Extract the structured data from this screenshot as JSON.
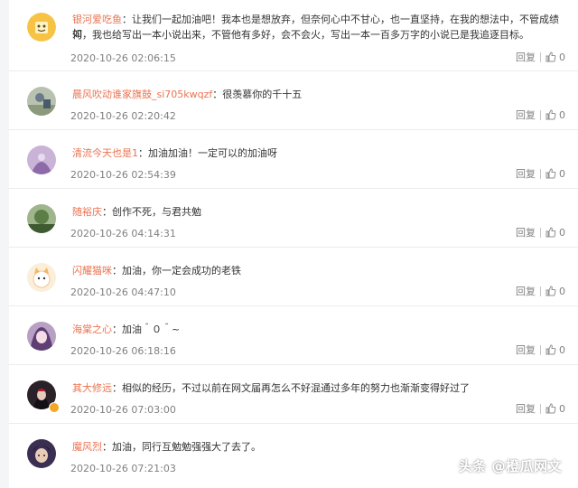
{
  "comments": [
    {
      "user": "银河爱吃鱼",
      "text_l1": "让我们一起加油吧！我本也是想放弃，但奈何心中不甘心，也一直坚持，在我的想法中，不管成绩如",
      "text_l2": "何，我也给写出一本小说出来，不管他有多好，会不会火，写出一本一百多万字的小说已是我追逐目标。",
      "time": "2020-10-26 02:06:15",
      "reply": "回复",
      "likes": "0",
      "avatar_icon": "yellow-cartoon-avatar"
    },
    {
      "user": "晨风吹动谁家旗鼓_si705kwqzf",
      "text_l1": "很羡慕你的千十五",
      "time": "2020-10-26 02:20:42",
      "reply": "回复",
      "likes": "0",
      "avatar_icon": "photo-avatar"
    },
    {
      "user": "清流今天也是1",
      "text_l1": "加油加油！一定可以的加油呀",
      "time": "2020-10-26 02:54:39",
      "reply": "回复",
      "likes": "0",
      "avatar_icon": "purple-avatar"
    },
    {
      "user": "随裕庆",
      "text_l1": "创作不死，与君共勉",
      "time": "2020-10-26 04:14:31",
      "reply": "回复",
      "likes": "0",
      "avatar_icon": "landscape-avatar"
    },
    {
      "user": "闪耀猫咪",
      "text_l1": "加油，你一定会成功的老铁",
      "time": "2020-10-26 04:47:10",
      "reply": "回复",
      "likes": "0",
      "avatar_icon": "cat-avatar"
    },
    {
      "user": "海棠之心",
      "text_l1": "加油＾０＾~",
      "time": "2020-10-26 06:18:16",
      "reply": "回复",
      "likes": "0",
      "avatar_icon": "anime-avatar"
    },
    {
      "user": "其大修远",
      "text_l1": "相似的经历，不过以前在网文届再怎么不好混通过多年的努力也渐渐变得好过了",
      "time": "2020-10-26 07:03:00",
      "reply": "回复",
      "likes": "0",
      "avatar_icon": "dark-avatar"
    },
    {
      "user": "魔风烈",
      "text_l1": "加油，同行互勉勉强强大了去了。",
      "time": "2020-10-26 07:21:03",
      "reply": "回复",
      "likes": "0",
      "avatar_icon": "character-avatar"
    }
  ],
  "separator": "：",
  "watermark": "头条 @橙瓜网文",
  "colors": {
    "username": "#eb7350",
    "text": "#333333",
    "meta": "#808080"
  }
}
